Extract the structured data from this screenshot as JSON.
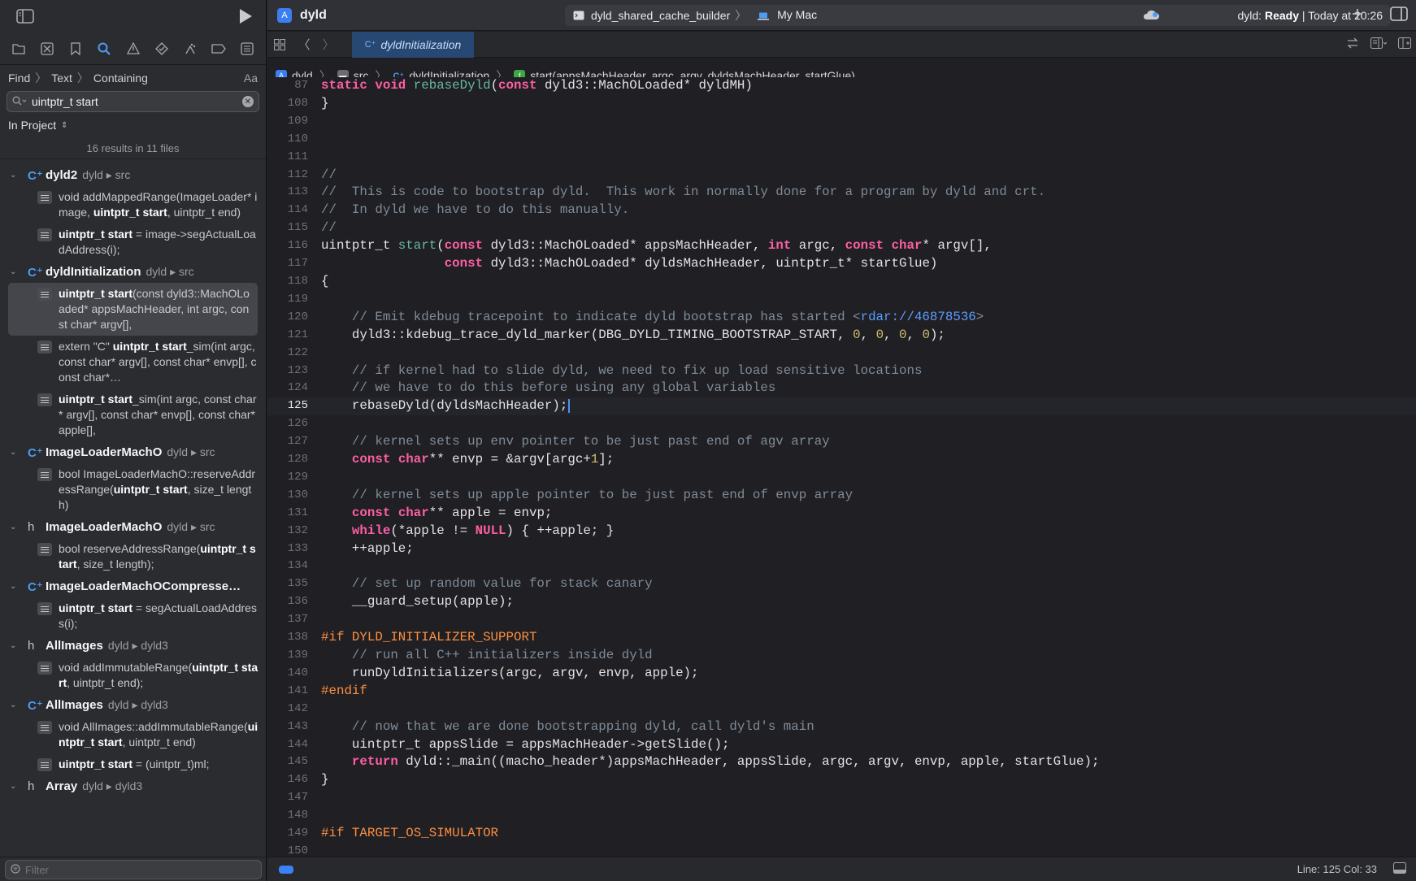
{
  "navigator": {
    "find_path": [
      "Find",
      "Text",
      "Containing"
    ],
    "case_toggle": "Aa",
    "search_query": "uintptr_t start",
    "scope": "In Project",
    "results_summary": "16 results in 11 files",
    "filter_placeholder": "Filter"
  },
  "results": [
    {
      "type": "c",
      "type_label": "C⁺",
      "name": "dyld2",
      "path": "dyld ▸ src",
      "matches": [
        {
          "parts": [
            [
              "void addMappedRange(ImageLoader* image, ",
              false
            ],
            [
              "uintptr_t start",
              true
            ],
            [
              ", uintptr_t end)",
              false
            ]
          ]
        },
        {
          "parts": [
            [
              "uintptr_t start",
              true
            ],
            [
              " = image->segActualLoadAddress(i);",
              false
            ]
          ]
        }
      ]
    },
    {
      "type": "c",
      "type_label": "C⁺",
      "name": "dyldInitialization",
      "path": "dyld ▸ src",
      "matches": [
        {
          "selected": true,
          "parts": [
            [
              "uintptr_t start",
              true
            ],
            [
              "(const dyld3::MachOLoaded* appsMachHeader, int argc, const char* argv[],",
              false
            ]
          ]
        },
        {
          "parts": [
            [
              "extern \"C\" ",
              false
            ],
            [
              "uintptr_t start",
              true
            ],
            [
              "_sim(int argc, const char* argv[], const char* envp[], const char*…",
              false
            ]
          ]
        },
        {
          "parts": [
            [
              "uintptr_t start",
              true
            ],
            [
              "_sim(int argc, const char* argv[], const char* envp[], const char* apple[],",
              false
            ]
          ]
        }
      ]
    },
    {
      "type": "c",
      "type_label": "C⁺",
      "name": "ImageLoaderMachO",
      "path": "dyld ▸ src",
      "matches": [
        {
          "parts": [
            [
              "bool ImageLoaderMachO::reserveAddressRange(",
              false
            ],
            [
              "uintptr_t start",
              true
            ],
            [
              ", size_t length)",
              false
            ]
          ]
        }
      ]
    },
    {
      "type": "h",
      "type_label": "h",
      "name": "ImageLoaderMachO",
      "path": "dyld ▸ src",
      "matches": [
        {
          "parts": [
            [
              "bool        reserveAddressRange(",
              false
            ],
            [
              "uintptr_t start",
              true
            ],
            [
              ", size_t length);",
              false
            ]
          ]
        }
      ]
    },
    {
      "type": "c",
      "type_label": "C⁺",
      "name": "ImageLoaderMachOCompresse…",
      "path": "",
      "matches": [
        {
          "parts": [
            [
              "uintptr_t start",
              true
            ],
            [
              " = segActualLoadAddress(i);",
              false
            ]
          ]
        }
      ]
    },
    {
      "type": "h",
      "type_label": "h",
      "name": "AllImages",
      "path": "dyld ▸ dyld3",
      "matches": [
        {
          "parts": [
            [
              "void                 addImmutableRange(",
              false
            ],
            [
              "uintptr_t start",
              true
            ],
            [
              ", uintptr_t end);",
              false
            ]
          ]
        }
      ]
    },
    {
      "type": "c",
      "type_label": "C⁺",
      "name": "AllImages",
      "path": "dyld ▸ dyld3",
      "matches": [
        {
          "parts": [
            [
              "void AllImages::addImmutableRange(",
              false
            ],
            [
              "uintptr_t start",
              true
            ],
            [
              ", uintptr_t end)",
              false
            ]
          ]
        },
        {
          "parts": [
            [
              "uintptr_t start",
              true
            ],
            [
              " = (uintptr_t)ml;",
              false
            ]
          ]
        }
      ]
    },
    {
      "type": "h",
      "type_label": "h",
      "name": "Array",
      "path": "dyld ▸ dyld3",
      "matches": []
    }
  ],
  "toolbar": {
    "project": "dyld",
    "scheme": "dyld_shared_cache_builder",
    "destination": "My Mac",
    "status_prefix": "dyld: ",
    "status_state": "Ready",
    "status_time": " | Today at 20:26"
  },
  "tab": {
    "label": "dyldInitialization",
    "type_label": "C⁺"
  },
  "jumpbar": [
    {
      "label": "dyld",
      "icon": "project-icon",
      "color": "#3b7ef0",
      "glyph": "A"
    },
    {
      "label": "src",
      "icon": "folder-icon",
      "color": "#6b6b70",
      "glyph": "▬"
    },
    {
      "label": "dyldInitialization",
      "icon": "cpp-file-icon",
      "color": "transparent",
      "glyph": "C⁺"
    },
    {
      "label": "start(appsMachHeader, argc, argv, dyldsMachHeader, startGlue)",
      "icon": "function-icon",
      "color": "#3fa845",
      "glyph": "f"
    }
  ],
  "editor": {
    "current_line": 125,
    "lines": [
      {
        "n": 87,
        "t": [
          [
            "kw",
            "static "
          ],
          [
            "kw",
            "void "
          ],
          [
            "fn",
            "rebaseDyld"
          ],
          [
            "",
            "("
          ],
          [
            "kw",
            "const "
          ],
          [
            "",
            "dyld3::MachOLoaded* dyldMH)"
          ]
        ]
      },
      {
        "n": 108,
        "t": [
          [
            "",
            "}"
          ]
        ]
      },
      {
        "n": 109,
        "t": []
      },
      {
        "n": 110,
        "t": []
      },
      {
        "n": 111,
        "t": []
      },
      {
        "n": 112,
        "t": [
          [
            "cm",
            "//"
          ]
        ]
      },
      {
        "n": 113,
        "t": [
          [
            "cm",
            "//  This is code to bootstrap dyld.  This work in normally done for a program by dyld and crt."
          ]
        ]
      },
      {
        "n": 114,
        "t": [
          [
            "cm",
            "//  In dyld we have to do this manually."
          ]
        ]
      },
      {
        "n": 115,
        "t": [
          [
            "cm",
            "//"
          ]
        ]
      },
      {
        "n": 116,
        "t": [
          [
            "",
            "uintptr_t "
          ],
          [
            "fn",
            "start"
          ],
          [
            "",
            "("
          ],
          [
            "kw",
            "const "
          ],
          [
            "",
            "dyld3::MachOLoaded* appsMachHeader, "
          ],
          [
            "kw",
            "int "
          ],
          [
            "",
            "argc, "
          ],
          [
            "kw",
            "const "
          ],
          [
            "kw",
            "char"
          ],
          [
            "",
            "* argv[],"
          ]
        ]
      },
      {
        "n": 117,
        "t": [
          [
            "",
            "                "
          ],
          [
            "kw",
            "const "
          ],
          [
            "",
            "dyld3::MachOLoaded* dyldsMachHeader, uintptr_t* startGlue)"
          ]
        ]
      },
      {
        "n": 118,
        "t": [
          [
            "",
            "{"
          ]
        ]
      },
      {
        "n": 119,
        "t": []
      },
      {
        "n": 120,
        "t": [
          [
            "",
            "    "
          ],
          [
            "cm",
            "// Emit kdebug tracepoint to indicate dyld bootstrap has started <"
          ],
          [
            "lk",
            "rdar://46878536"
          ],
          [
            "cm",
            ">"
          ]
        ]
      },
      {
        "n": 121,
        "t": [
          [
            "",
            "    dyld3::kdebug_trace_dyld_marker(DBG_DYLD_TIMING_BOOTSTRAP_START, "
          ],
          [
            "num",
            "0"
          ],
          [
            "",
            ", "
          ],
          [
            "num",
            "0"
          ],
          [
            "",
            ", "
          ],
          [
            "num",
            "0"
          ],
          [
            "",
            ", "
          ],
          [
            "num",
            "0"
          ],
          [
            "",
            ");"
          ]
        ]
      },
      {
        "n": 122,
        "t": []
      },
      {
        "n": 123,
        "t": [
          [
            "",
            "    "
          ],
          [
            "cm",
            "// if kernel had to slide dyld, we need to fix up load sensitive locations"
          ]
        ]
      },
      {
        "n": 124,
        "t": [
          [
            "",
            "    "
          ],
          [
            "cm",
            "// we have to do this before using any global variables"
          ]
        ]
      },
      {
        "n": 125,
        "t": [
          [
            "",
            "    rebaseDyld(dyldsMachHeader);"
          ]
        ],
        "caret": true
      },
      {
        "n": 126,
        "t": []
      },
      {
        "n": 127,
        "t": [
          [
            "",
            "    "
          ],
          [
            "cm",
            "// kernel sets up env pointer to be just past end of agv array"
          ]
        ]
      },
      {
        "n": 128,
        "t": [
          [
            "",
            "    "
          ],
          [
            "kw",
            "const "
          ],
          [
            "kw",
            "char"
          ],
          [
            "",
            "** envp = &argv[argc+"
          ],
          [
            "num",
            "1"
          ],
          [
            "",
            "];"
          ]
        ]
      },
      {
        "n": 129,
        "t": []
      },
      {
        "n": 130,
        "t": [
          [
            "",
            "    "
          ],
          [
            "cm",
            "// kernel sets up apple pointer to be just past end of envp array"
          ]
        ]
      },
      {
        "n": 131,
        "t": [
          [
            "",
            "    "
          ],
          [
            "kw",
            "const "
          ],
          [
            "kw",
            "char"
          ],
          [
            "",
            "** apple = envp;"
          ]
        ]
      },
      {
        "n": 132,
        "t": [
          [
            "",
            "    "
          ],
          [
            "kw",
            "while"
          ],
          [
            "",
            "(*apple != "
          ],
          [
            "kw",
            "NULL"
          ],
          [
            "",
            ") { ++apple; }"
          ]
        ]
      },
      {
        "n": 133,
        "t": [
          [
            "",
            "    ++apple;"
          ]
        ]
      },
      {
        "n": 134,
        "t": []
      },
      {
        "n": 135,
        "t": [
          [
            "",
            "    "
          ],
          [
            "cm",
            "// set up random value for stack canary"
          ]
        ]
      },
      {
        "n": 136,
        "t": [
          [
            "",
            "    __guard_setup(apple);"
          ]
        ]
      },
      {
        "n": 137,
        "t": []
      },
      {
        "n": 138,
        "t": [
          [
            "pp",
            "#if DYLD_INITIALIZER_SUPPORT"
          ]
        ]
      },
      {
        "n": 139,
        "t": [
          [
            "",
            "    "
          ],
          [
            "cm",
            "// run all C++ initializers inside dyld"
          ]
        ]
      },
      {
        "n": 140,
        "t": [
          [
            "",
            "    runDyldInitializers(argc, argv, envp, apple);"
          ]
        ]
      },
      {
        "n": 141,
        "t": [
          [
            "pp",
            "#endif"
          ]
        ]
      },
      {
        "n": 142,
        "t": []
      },
      {
        "n": 143,
        "t": [
          [
            "",
            "    "
          ],
          [
            "cm",
            "// now that we are done bootstrapping dyld, call dyld's main"
          ]
        ]
      },
      {
        "n": 144,
        "t": [
          [
            "",
            "    uintptr_t appsSlide = appsMachHeader->getSlide();"
          ]
        ]
      },
      {
        "n": 145,
        "t": [
          [
            "",
            "    "
          ],
          [
            "kw",
            "return "
          ],
          [
            "",
            "dyld::_main((macho_header*)appsMachHeader, appsSlide, argc, argv, envp, apple, startGlue);"
          ]
        ]
      },
      {
        "n": 146,
        "t": [
          [
            "",
            "}"
          ]
        ]
      },
      {
        "n": 147,
        "t": []
      },
      {
        "n": 148,
        "t": []
      },
      {
        "n": 149,
        "t": [
          [
            "pp",
            "#if TARGET_OS_SIMULATOR"
          ]
        ]
      },
      {
        "n": 150,
        "t": []
      }
    ]
  },
  "status": {
    "line_col": "Line: 125  Col: 33"
  }
}
